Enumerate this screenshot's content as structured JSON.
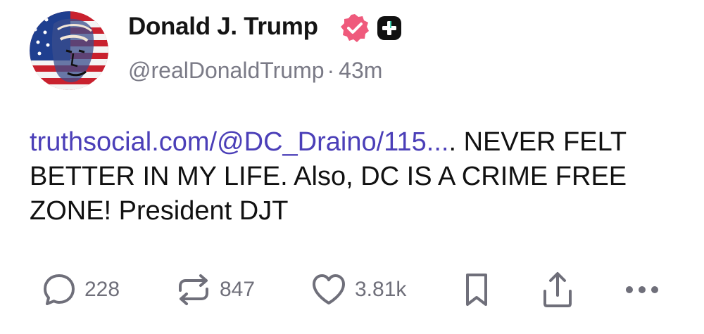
{
  "author": {
    "display_name": "Donald J. Trump",
    "handle": "@realDonaldTrump",
    "separator": "·",
    "timestamp": "43m",
    "verified_icon": "verified-badge-icon",
    "badge_icon": "plus-badge-icon",
    "avatar_icon": "avatar-flag-portrait"
  },
  "post": {
    "link_text": "truthsocial.com/@DC_Draino/115...",
    "text": ". NEVER FELT BETTER IN MY LIFE. Also, DC IS A CRIME FREE ZONE! President DJT"
  },
  "actions": {
    "reply_count": "228",
    "retruth_count": "847",
    "like_count": "3.81k",
    "icons": [
      "reply-icon",
      "retruth-icon",
      "like-icon",
      "bookmark-icon",
      "share-icon",
      "more-icon"
    ]
  },
  "colors": {
    "link": "#4b3fb8",
    "verified": "#ef5a7c",
    "muted": "#7a7a86",
    "badge": "#111111"
  }
}
